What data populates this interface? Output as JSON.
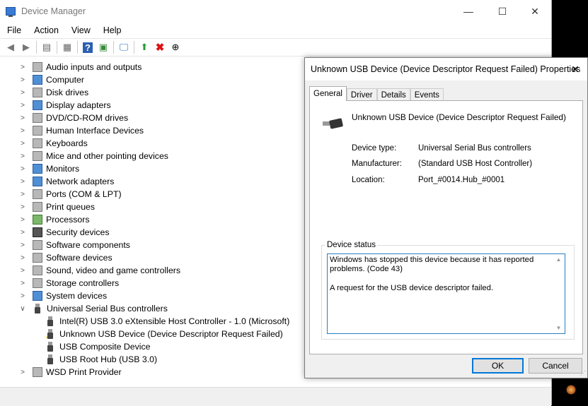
{
  "window": {
    "title": "Device Manager",
    "min": "—",
    "max": "☐",
    "close": "✕"
  },
  "menu": [
    "File",
    "Action",
    "View",
    "Help"
  ],
  "tree": {
    "categories": [
      "Audio inputs and outputs",
      "Computer",
      "Disk drives",
      "Display adapters",
      "DVD/CD-ROM drives",
      "Human Interface Devices",
      "Keyboards",
      "Mice and other pointing devices",
      "Monitors",
      "Network adapters",
      "Ports (COM & LPT)",
      "Print queues",
      "Processors",
      "Security devices",
      "Software components",
      "Software devices",
      "Sound, video and game controllers",
      "Storage controllers",
      "System devices"
    ],
    "usb_category": "Universal Serial Bus controllers",
    "usb_children": [
      "Intel(R) USB 3.0 eXtensible Host Controller - 1.0 (Microsoft)",
      "Unknown USB Device (Device Descriptor Request Failed)",
      "USB Composite Device",
      "USB Root Hub (USB 3.0)"
    ],
    "last_category": "WSD Print Provider"
  },
  "dialog": {
    "title": "Unknown USB Device (Device Descriptor Request Failed) Properties",
    "close": "✕",
    "tabs": [
      "General",
      "Driver",
      "Details",
      "Events"
    ],
    "device_name": "Unknown USB Device (Device Descriptor Request Failed)",
    "props": [
      {
        "label": "Device type:",
        "value": "Universal Serial Bus controllers"
      },
      {
        "label": "Manufacturer:",
        "value": "(Standard USB Host Controller)"
      },
      {
        "label": "Location:",
        "value": "Port_#0014.Hub_#0001"
      }
    ],
    "status_legend": "Device status",
    "status_line1": "Windows has stopped this device because it has reported problems. (Code 43)",
    "status_line2": "A request for the USB device descriptor failed.",
    "ok": "OK",
    "cancel": "Cancel"
  }
}
